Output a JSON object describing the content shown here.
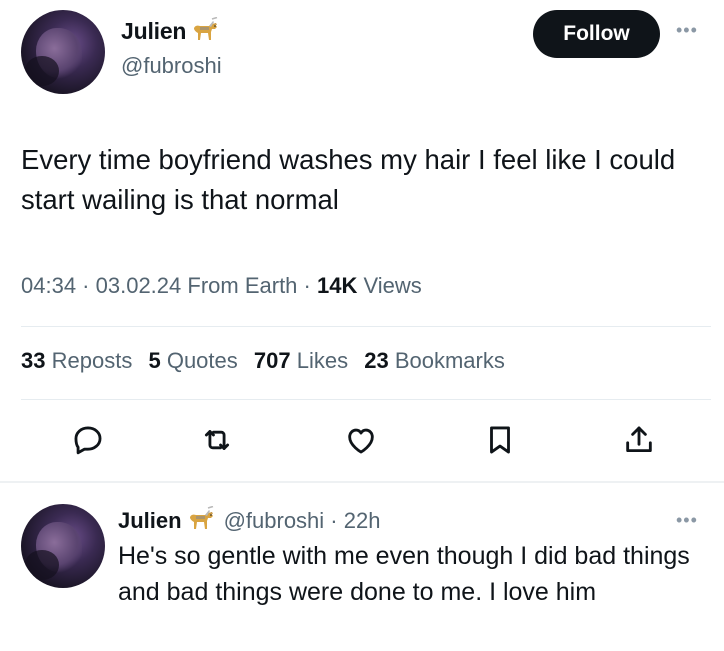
{
  "tweet": {
    "author": {
      "name": "Julien",
      "handle": "@fubroshi",
      "badge_icon": "guide-dog-icon"
    },
    "follow_label": "Follow",
    "text": "Every time boyfriend washes my hair I feel like I could start wailing is that normal",
    "meta": {
      "time": "04:34",
      "date": "03.02.24",
      "source": "From Earth",
      "views_count": "14K",
      "views_label": "Views"
    },
    "stats": [
      {
        "count": "33",
        "label": "Reposts"
      },
      {
        "count": "5",
        "label": "Quotes"
      },
      {
        "count": "707",
        "label": "Likes"
      },
      {
        "count": "23",
        "label": "Bookmarks"
      }
    ],
    "actions": [
      "reply-icon",
      "repost-icon",
      "like-icon",
      "bookmark-icon",
      "share-icon"
    ]
  },
  "reply": {
    "name": "Julien",
    "handle": "@fubroshi",
    "age": "22h",
    "text": "He's so gentle with me even though I did bad things and bad things were done to me. I love him"
  },
  "colors": {
    "text": "#0f1419",
    "secondary": "#536471",
    "divider": "#e6ecf0",
    "follow_bg": "#0f1419"
  }
}
